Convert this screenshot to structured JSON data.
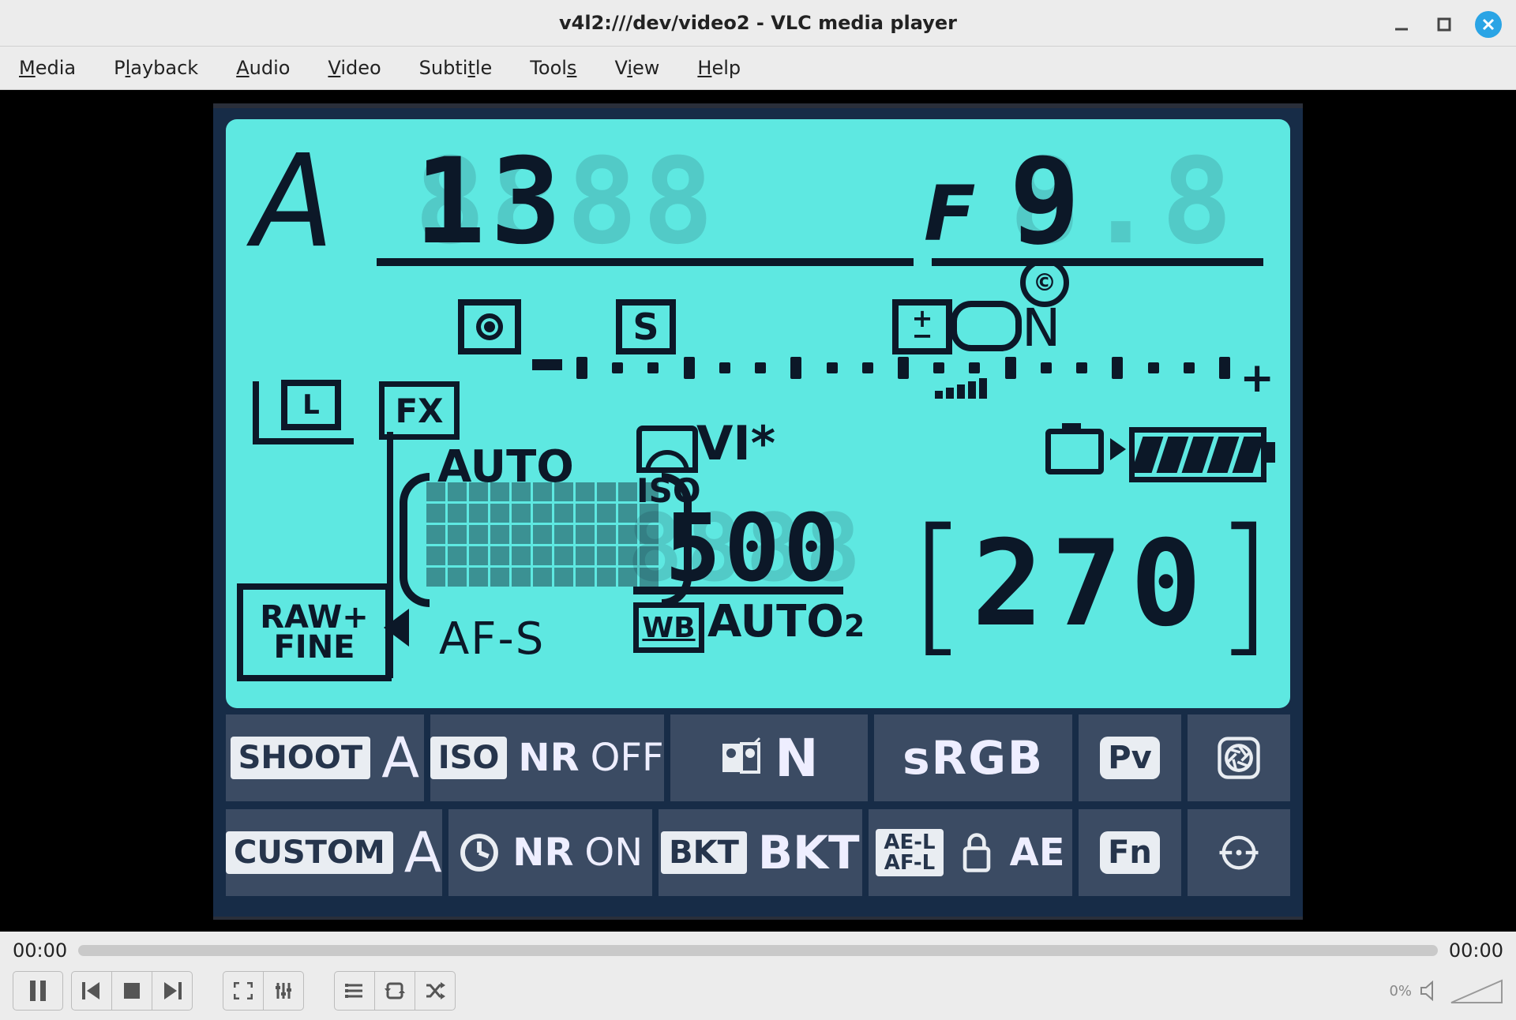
{
  "titlebar": {
    "title": "v4l2:///dev/video2 - VLC media player"
  },
  "menu": {
    "media": "Media",
    "playback": "Playback",
    "audio": "Audio",
    "video": "Video",
    "subtitle": "Subtitle",
    "tools": "Tools",
    "view": "View",
    "help": "Help"
  },
  "lcd": {
    "mode": "A",
    "shutter_ghost": "8888",
    "shutter": "  13",
    "aperture_prefix": "F",
    "aperture_ghost": "8.8",
    "aperture": "9  ",
    "metering": "center-weighted",
    "release_mode": "S",
    "picture_control_n": "N",
    "copyright": "©",
    "exposure_minus": "−",
    "exposure_plus": "+",
    "image_area": "FX",
    "image_size": "L",
    "quality": "RAW+\nFINE",
    "af_area_mode": "AUTO",
    "af_mode": "AF-S",
    "picture_control": "VI*",
    "iso_label": "ISO",
    "iso_ghost": "8888",
    "iso": "500",
    "wb_label": "WB",
    "wb_value": "AUTO",
    "wb_sub": "2",
    "shots_remaining": "270",
    "battery_bars": 5
  },
  "info_row1": {
    "shoot_pill": "SHOOT",
    "shoot_val": "A",
    "iso_pill": "ISO",
    "nr": "NR",
    "nr_state": "OFF",
    "adl_n": "N",
    "colorspace": "sRGB",
    "pv": "Pv"
  },
  "info_row2": {
    "custom_pill": "CUSTOM",
    "custom_val": "A",
    "nr": "NR",
    "nr_state": "ON",
    "bkt_pill": "BKT",
    "bkt": "BKT",
    "ael": "AE-L\nAF-L",
    "ae": "AE",
    "fn": "Fn"
  },
  "player": {
    "elapsed": "00:00",
    "total": "00:00",
    "volume_pct": "0%"
  }
}
